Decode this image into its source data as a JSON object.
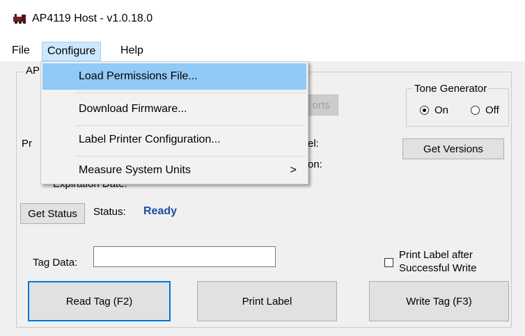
{
  "window": {
    "title": "AP4119 Host - v1.0.18.0"
  },
  "menubar": {
    "file": "File",
    "configure": "Configure",
    "help": "Help"
  },
  "configure_menu": {
    "items": [
      {
        "label": "Load Permissions File..."
      },
      {
        "label": "Download Firmware..."
      },
      {
        "label": "Label Printer Configuration..."
      },
      {
        "label": "Measure System Units",
        "submenu_arrow": ">"
      }
    ]
  },
  "main_group": {
    "title_partial": "AP",
    "ports_button_partial": "orts",
    "left_label_partial": "Pr",
    "label_partial_1": "el:",
    "label_partial_2": "on:",
    "expiration_label": "Expiration Date:"
  },
  "tone_generator": {
    "title": "Tone Generator",
    "on_label": "On",
    "off_label": "Off",
    "selected": "On"
  },
  "buttons": {
    "get_versions": "Get Versions",
    "get_status": "Get Status",
    "read_tag": "Read Tag (F2)",
    "print_label": "Print Label",
    "write_tag": "Write Tag (F3)"
  },
  "status": {
    "label": "Status:",
    "value": "Ready",
    "value_color": "#1c4fa0"
  },
  "tag_data": {
    "label": "Tag Data:",
    "value": ""
  },
  "print_after_write": {
    "label_line1": "Print Label after",
    "label_line2": "Successful Write",
    "checked": false
  },
  "colors": {
    "menu_highlight": "#91c9f7",
    "accent": "#0078d7"
  }
}
